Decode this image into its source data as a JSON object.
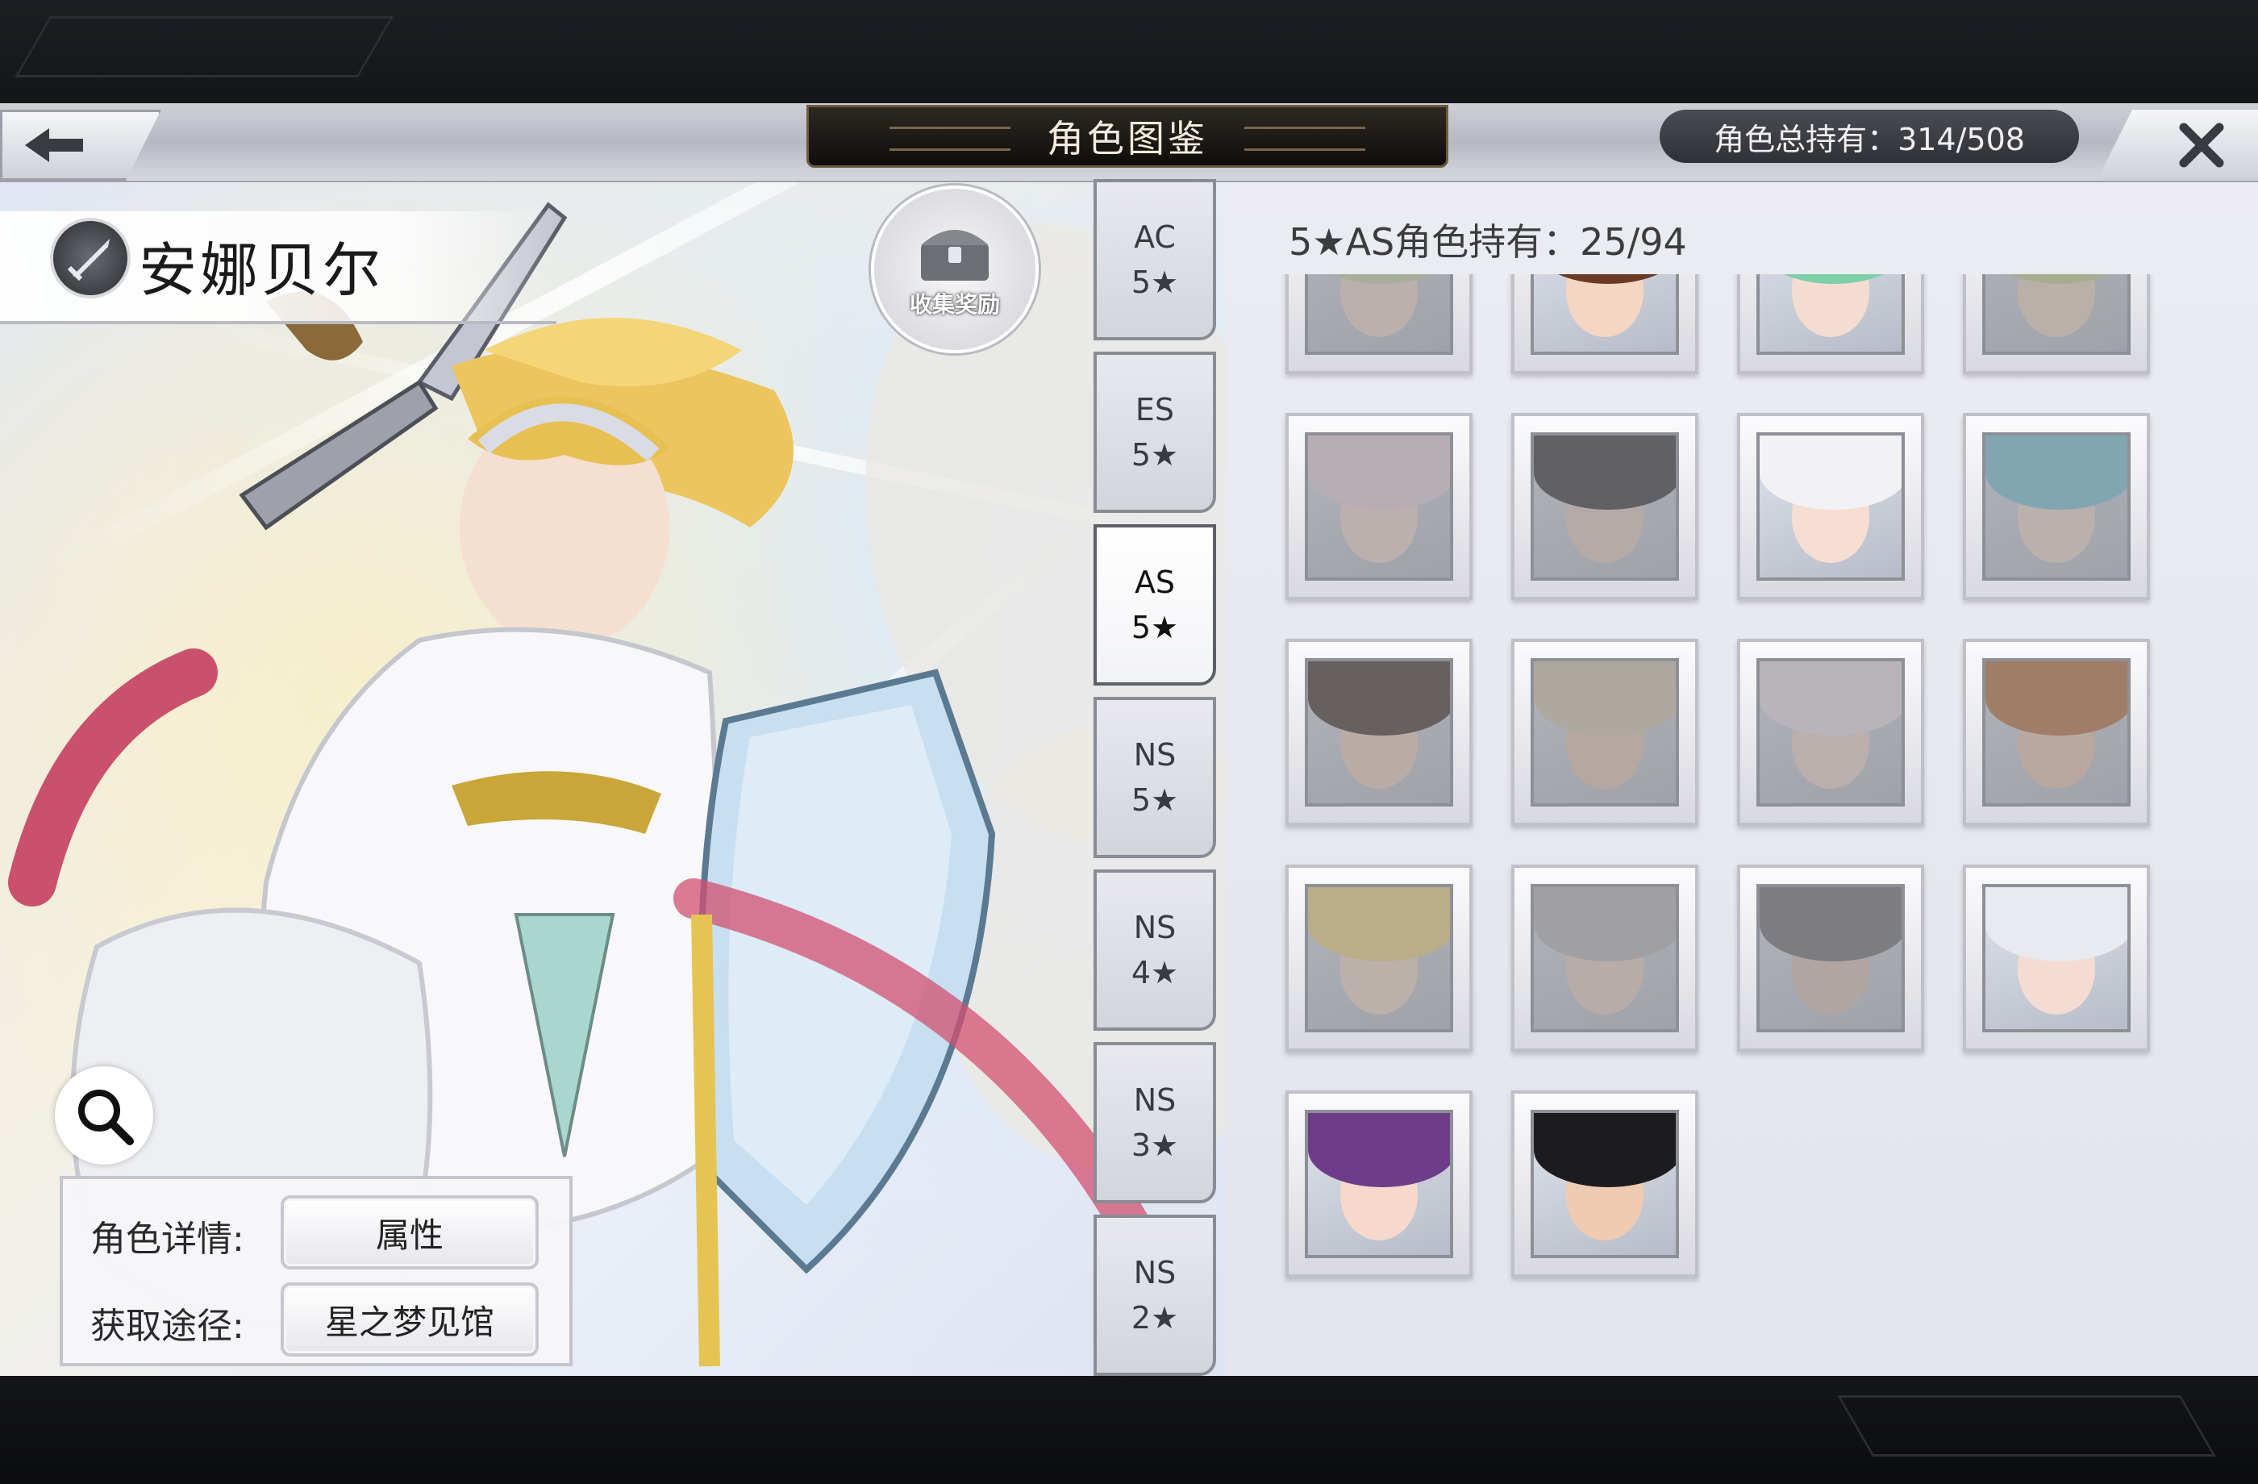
{
  "header": {
    "title": "角色图鉴",
    "total_owned": "角色总持有：314/508"
  },
  "character": {
    "name": "安娜贝尔",
    "reward_label": "收集奖励",
    "details_label": "角色详情:",
    "details_button": "属性",
    "source_label": "获取途径:",
    "source_button": "星之梦见馆"
  },
  "tabs": [
    {
      "line1": "AC",
      "line2": "5★"
    },
    {
      "line1": "ES",
      "line2": "5★"
    },
    {
      "line1": "AS",
      "line2": "5★"
    },
    {
      "line1": "NS",
      "line2": "5★"
    },
    {
      "line1": "NS",
      "line2": "4★"
    },
    {
      "line1": "NS",
      "line2": "3★"
    },
    {
      "line1": "NS",
      "line2": "2★"
    }
  ],
  "active_tab": 2,
  "list": {
    "title": "5★AS角色持有：25/94",
    "cards": [
      {
        "owned": false,
        "hair": "#c8d9a4",
        "skin": "#f3dccb"
      },
      {
        "owned": true,
        "hair": "#6b3a22",
        "skin": "#f5d6c2"
      },
      {
        "owned": true,
        "hair": "#7ccfa8",
        "skin": "#f4dcd0"
      },
      {
        "owned": false,
        "hair": "#c5d88e",
        "skin": "#f0ddc4"
      },
      {
        "owned": false,
        "hair": "#e9d6df",
        "skin": "#f5dcd0"
      },
      {
        "owned": false,
        "hair": "#2c2c30",
        "skin": "#e8cfc0"
      },
      {
        "owned": true,
        "hair": "#f2f2f5",
        "skin": "#f6ded2"
      },
      {
        "owned": false,
        "hair": "#76c6d8",
        "skin": "#f2dccc"
      },
      {
        "owned": false,
        "hair": "#3d2a22",
        "skin": "#f0d0bc"
      },
      {
        "owned": false,
        "hair": "#d9cbb4",
        "skin": "#e5cbb2"
      },
      {
        "owned": false,
        "hair": "#efe4ea",
        "skin": "#f3d9cf"
      },
      {
        "owned": false,
        "hair": "#b86a35",
        "skin": "#eec9b0"
      },
      {
        "owned": false,
        "hair": "#f1d67b",
        "skin": "#f6dcc8"
      },
      {
        "owned": false,
        "hair": "#b9b6b3",
        "skin": "#ead3c3"
      },
      {
        "owned": false,
        "hair": "#6b6a6e",
        "skin": "#dcc4b4"
      },
      {
        "owned": true,
        "hair": "#e9eaf0",
        "skin": "#f5dbd1"
      },
      {
        "owned": true,
        "hair": "#6e3d8a",
        "skin": "#f6d8cc"
      },
      {
        "owned": true,
        "hair": "#1c1c20",
        "skin": "#eecbb1"
      }
    ]
  },
  "colors": {
    "panel_bg": "#e6e7ee",
    "title_bar": "#1a1714",
    "pill": "#3b3d43"
  }
}
